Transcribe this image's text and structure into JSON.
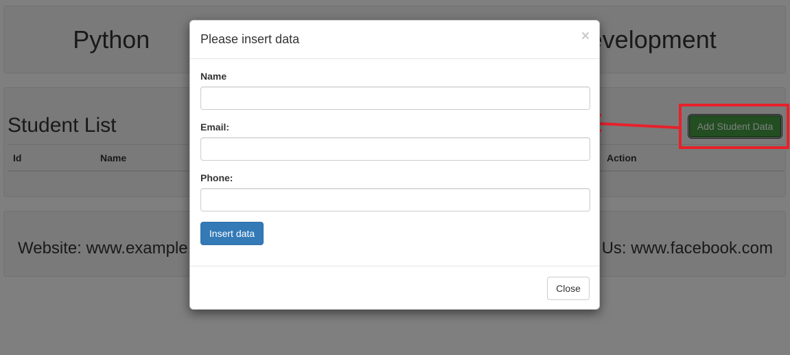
{
  "page": {
    "title": "Python Web Development",
    "list_title": "Student List",
    "add_button": "Add Student Data",
    "table_headers": {
      "id": "Id",
      "name": "Name",
      "action": "Action"
    },
    "footer": {
      "website": "Website: www.example.com",
      "social": "Like Us: www.facebook.com"
    }
  },
  "modal": {
    "title": "Please insert data",
    "close_symbol": "×",
    "fields": {
      "name_label": "Name",
      "email_label": "Email:",
      "phone_label": "Phone:"
    },
    "insert_button": "Insert data",
    "close_button": "Close"
  },
  "colors": {
    "annotation": "#e8202a",
    "primary": "#337ab7",
    "success": "#449d44"
  }
}
